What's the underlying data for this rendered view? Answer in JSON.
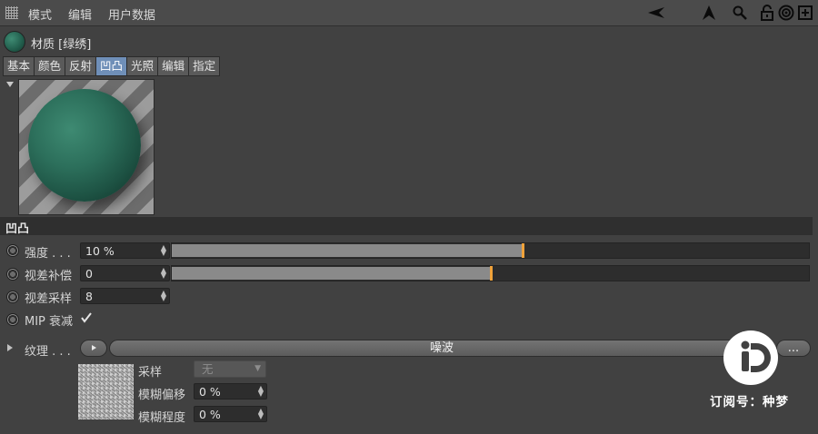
{
  "menubar": {
    "items": [
      "模式",
      "编辑",
      "用户数据"
    ],
    "icons": [
      "arrow-left-icon",
      "arrow-up-icon",
      "search-icon",
      "lock-icon",
      "target-icon",
      "add-panel-icon"
    ]
  },
  "material": {
    "title": "材质 [绿绣]"
  },
  "tabs": [
    {
      "label": "基本",
      "active": false
    },
    {
      "label": "颜色",
      "active": false
    },
    {
      "label": "反射",
      "active": false
    },
    {
      "label": "凹凸",
      "active": true
    },
    {
      "label": "光照",
      "active": false
    },
    {
      "label": "编辑",
      "active": false
    },
    {
      "label": "指定",
      "active": false
    }
  ],
  "section": {
    "title": "凹凸"
  },
  "params": {
    "strength": {
      "label": "强度 . . .",
      "value": "10 %",
      "slider_fraction": 0.55
    },
    "parallax_offset": {
      "label": "视差补偿",
      "value": "0",
      "slider_fraction": 0.5
    },
    "parallax_samples": {
      "label": "视差采样",
      "value": "8"
    },
    "mip_falloff": {
      "label": "MIP 衰减",
      "checked": true
    }
  },
  "texture": {
    "label": "纹理 . . .",
    "shader_name": "噪波",
    "more_button": "...",
    "sampling_label": "采样",
    "sampling_value": "无",
    "blur_offset_label": "模糊偏移",
    "blur_offset_value": "0 %",
    "blur_scale_label": "模糊程度",
    "blur_scale_value": "0 %"
  },
  "watermark": {
    "text": "订阅号：种梦"
  },
  "colors": {
    "accent": "#6f8fb8",
    "handle": "#f0a23a",
    "background": "#414141"
  }
}
